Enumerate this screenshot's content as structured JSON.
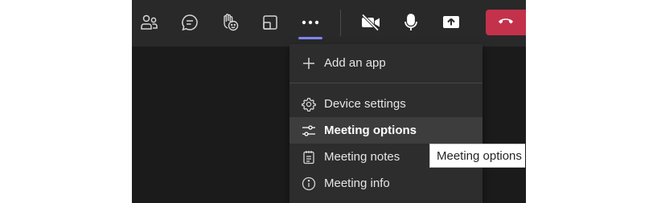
{
  "toolbar": {
    "buttons": [
      {
        "name": "people",
        "icon": "people-icon"
      },
      {
        "name": "chat",
        "icon": "chat-bubble-icon"
      },
      {
        "name": "react",
        "icon": "raise-hand-icon"
      },
      {
        "name": "rooms",
        "icon": "breakout-rooms-icon"
      },
      {
        "name": "more",
        "icon": "more-dots-icon",
        "active": true
      },
      {
        "name": "camera",
        "icon": "camera-off-icon"
      },
      {
        "name": "mic",
        "icon": "microphone-icon"
      },
      {
        "name": "share",
        "icon": "share-screen-icon"
      },
      {
        "name": "leave",
        "icon": "hang-up-icon"
      }
    ],
    "accent_color": "#7f85f5",
    "leave_color": "#c4314b"
  },
  "more_menu": {
    "items": [
      {
        "label": "Add an app",
        "icon": "plus-icon"
      },
      {
        "label": "Device settings",
        "icon": "gear-icon"
      },
      {
        "label": "Meeting options",
        "icon": "sliders-icon",
        "hovered": true
      },
      {
        "label": "Meeting notes",
        "icon": "notes-icon"
      },
      {
        "label": "Meeting info",
        "icon": "info-icon"
      }
    ]
  },
  "tooltip": {
    "text": "Meeting options"
  }
}
